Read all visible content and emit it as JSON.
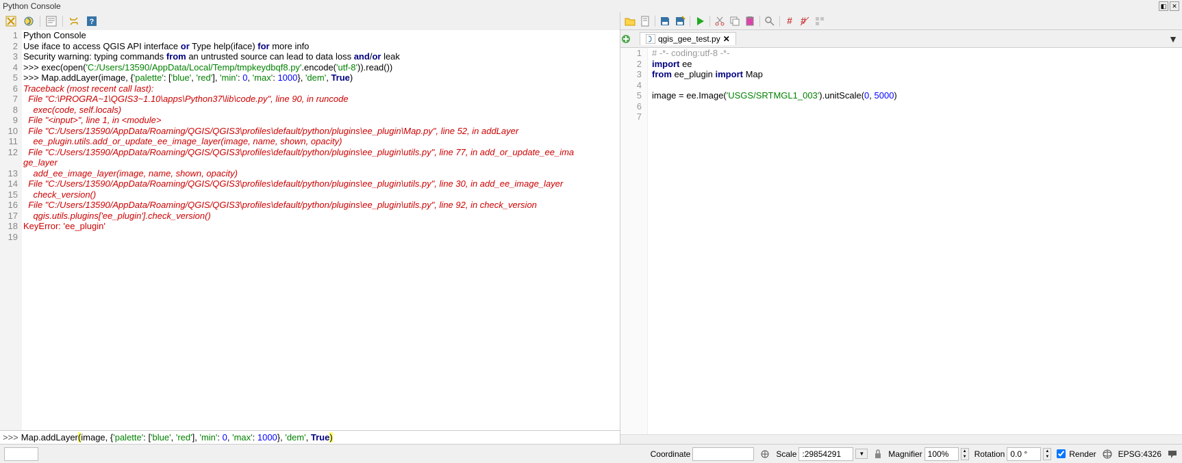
{
  "title": "Python Console",
  "console": {
    "lines": [
      {
        "n": 1,
        "html": "Python Console"
      },
      {
        "n": 2,
        "html": "Use iface to access QGIS API interface <span class='kw'>or</span> Type help(iface) <span class='kw'>for</span> more info"
      },
      {
        "n": 3,
        "html": "Security warning: typing commands <span class='kw'>from</span> an untrusted source can lead to data loss <span class='kw'>and</span>/<span class='kw'>or</span> leak"
      },
      {
        "n": 4,
        "html": ">>> exec(open(<span class='str'>'C:/Users/13590/AppData/Local/Temp/tmpkeydbqf8.py'</span>.encode(<span class='str'>'utf-8'</span>)).read())"
      },
      {
        "n": 5,
        "html": ">>> Map.addLayer(image, {<span class='str'>'palette'</span>: [<span class='str'>'blue'</span>, <span class='str'>'red'</span>], <span class='str'>'min'</span>: <span class='num'>0</span>, <span class='str'>'max'</span>: <span class='num'>1000</span>}, <span class='str'>'dem'</span>, <span class='kw'>True</span>)"
      },
      {
        "n": 6,
        "html": "<span class='trace'>Traceback (most recent call last):</span>"
      },
      {
        "n": 7,
        "html": "<span class='trace'>  File \"C:\\PROGRA~1\\QGIS3~1.10\\apps\\Python37\\lib\\code.py\", line 90, in runcode</span>"
      },
      {
        "n": 8,
        "html": "<span class='trace'>    exec(code, self.locals)</span>"
      },
      {
        "n": 9,
        "html": "<span class='trace'>  File \"&lt;input&gt;\", line 1, in &lt;module&gt;</span>"
      },
      {
        "n": 10,
        "html": "<span class='trace'>  File \"C:/Users/13590/AppData/Roaming/QGIS/QGIS3\\profiles\\default/python/plugins\\ee_plugin\\Map.py\", line 52, in addLayer</span>"
      },
      {
        "n": 11,
        "html": "<span class='trace'>    ee_plugin.utils.add_or_update_ee_image_layer(image, name, shown, opacity)</span>"
      },
      {
        "n": 12,
        "html": "<span class='trace'>  File \"C:/Users/13590/AppData/Roaming/QGIS/QGIS3\\profiles\\default/python/plugins\\ee_plugin\\utils.py\", line 77, in add_or_update_ee_ima</span>"
      },
      {
        "n": "",
        "html": "<span class='trace'>ge_layer</span>"
      },
      {
        "n": 13,
        "html": "<span class='trace'>    add_ee_image_layer(image, name, shown, opacity)</span>"
      },
      {
        "n": 14,
        "html": "<span class='trace'>  File \"C:/Users/13590/AppData/Roaming/QGIS/QGIS3\\profiles\\default/python/plugins\\ee_plugin\\utils.py\", line 30, in add_ee_image_layer</span>"
      },
      {
        "n": 15,
        "html": "<span class='trace'>    check_version()</span>"
      },
      {
        "n": 16,
        "html": "<span class='trace'>  File \"C:/Users/13590/AppData/Roaming/QGIS/QGIS3\\profiles\\default/python/plugins\\ee_plugin\\utils.py\", line 92, in check_version</span>"
      },
      {
        "n": 17,
        "html": "<span class='trace'>    qgis.utils.plugins['ee_plugin'].check_version()</span>"
      },
      {
        "n": 18,
        "html": "<span class='err'>KeyError: 'ee_plugin'</span>"
      },
      {
        "n": 19,
        "html": ""
      }
    ],
    "input_html": "Map.addLayer<span class='hl'>(</span>image, {<span class='str'>'palette'</span>: [<span class='str'>'blue'</span>, <span class='str'>'red'</span>], <span class='str'>'min'</span>: <span class='num'>0</span>, <span class='str'>'max'</span>: <span class='num'>1000</span>}, <span class='str'>'dem'</span>, <span class='kw'>True</span><span class='hl'>)</span>"
  },
  "editor": {
    "tab_name": "qgis_gee_test.py",
    "lines": [
      {
        "n": 1,
        "html": "<span class='comment'># -*- coding:utf-8 -*-</span>"
      },
      {
        "n": 2,
        "html": "<span class='kw'>import</span> ee"
      },
      {
        "n": 3,
        "html": "<span class='kw'>from</span> ee_plugin <span class='kw'>import</span> Map"
      },
      {
        "n": 4,
        "html": ""
      },
      {
        "n": 5,
        "html": "image = ee.Image(<span class='str'>'USGS/SRTMGL1_003'</span>).unitScale(<span class='num'>0</span>, <span class='num'>5000</span>)"
      },
      {
        "n": 6,
        "html": ""
      },
      {
        "n": 7,
        "html": ""
      }
    ]
  },
  "status": {
    "coordinate_label": "Coordinate",
    "coordinate_value": "",
    "scale_label": "Scale",
    "scale_value": ":29854291",
    "magnifier_label": "Magnifier",
    "magnifier_value": "100%",
    "rotation_label": "Rotation",
    "rotation_value": "0.0 °",
    "render_label": "Render",
    "epsg": "EPSG:4326"
  }
}
